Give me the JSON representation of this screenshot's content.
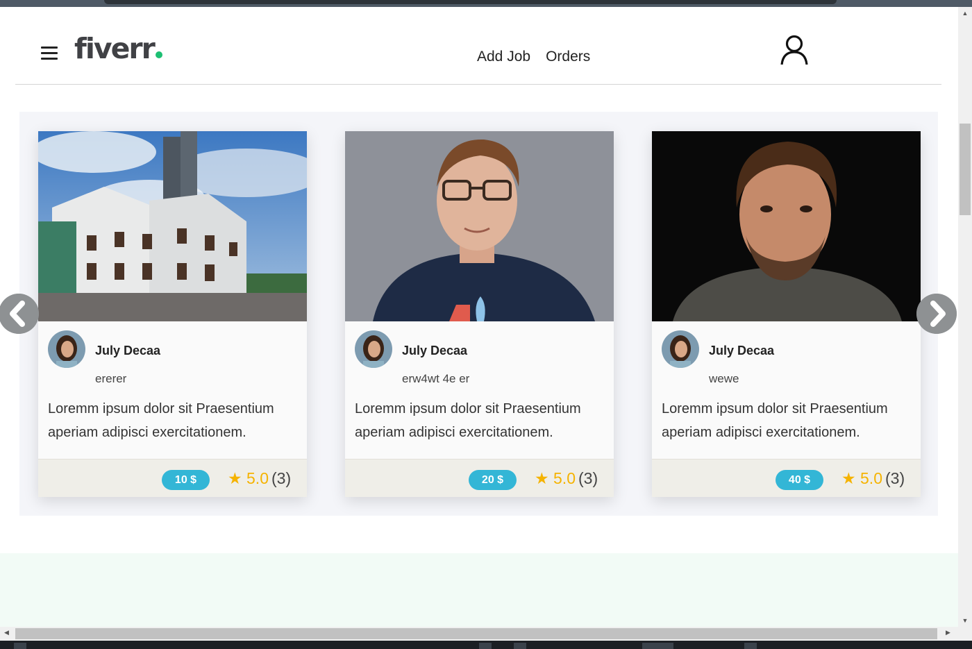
{
  "header": {
    "logo_text": "fiverr",
    "nav": [
      {
        "label": "Add Job"
      },
      {
        "label": "Orders"
      }
    ]
  },
  "gigs": [
    {
      "image": "building-photo",
      "author": "July Decaa",
      "subtitle": "ererer",
      "description": "Loremm ipsum dolor sit Praesentium aperiam adipisci exercitationem.",
      "price": "10 $",
      "rating": "5.0",
      "reviews": "(3)"
    },
    {
      "image": "man-glasses-photo",
      "author": "July Decaa",
      "subtitle": "erw4wt 4e er",
      "description": "Loremm ipsum dolor sit Praesentium aperiam adipisci exercitationem.",
      "price": "20 $",
      "rating": "5.0",
      "reviews": "(3)"
    },
    {
      "image": "man-beard-photo",
      "author": "July Decaa",
      "subtitle": "wewe",
      "description": "Loremm ipsum dolor sit Praesentium aperiam adipisci exercitationem.",
      "price": "40 $",
      "rating": "5.0",
      "reviews": "(3)"
    }
  ],
  "icons": {
    "menu": "hamburger-icon",
    "user": "user-icon",
    "prev": "chevron-left-icon",
    "next": "chevron-right-icon",
    "star": "star-icon"
  },
  "colors": {
    "brand_dot": "#1dbf73",
    "price_badge": "#33b6d6",
    "star": "#f5b301",
    "lower_band": "#f2fbf6"
  }
}
